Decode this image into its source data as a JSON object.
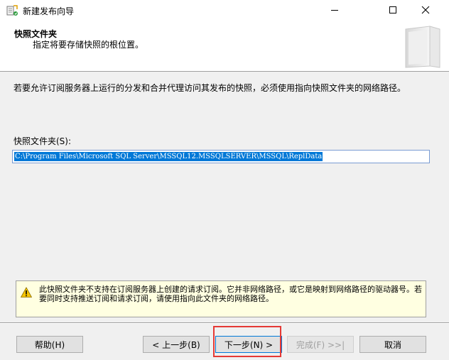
{
  "window": {
    "title": "新建发布向导",
    "controls": [
      "minimize-icon",
      "maximize-icon",
      "close-icon"
    ]
  },
  "header": {
    "title": "快照文件夹",
    "subtitle": "指定将要存储快照的根位置。"
  },
  "content": {
    "description": "若要允许订阅服务器上运行的分发和合并代理访问其发布的快照，必须使用指向快照文件夹的网络路径。",
    "folder_label": "快照文件夹(S):",
    "folder_value": "C:\\Program Files\\Microsoft SQL Server\\MSSQL12.MSSQLSERVER\\MSSQL\\ReplData"
  },
  "warning": {
    "icon": "warning-icon",
    "text": "此快照文件夹不支持在订阅服务器上创建的请求订阅。它并非网络路径，或它是映射到网络路径的驱动器号。若要同时支持推送订阅和请求订阅，请使用指向此文件夹的网络路径。"
  },
  "buttons": {
    "help": "帮助(H)",
    "back": "< 上一步(B)",
    "next": "下一步(N) >",
    "finish": "完成(F) >>|",
    "cancel": "取消"
  },
  "colors": {
    "selection": "#0078d7",
    "warning_bg": "#ffffe1",
    "highlight": "#e53935"
  }
}
